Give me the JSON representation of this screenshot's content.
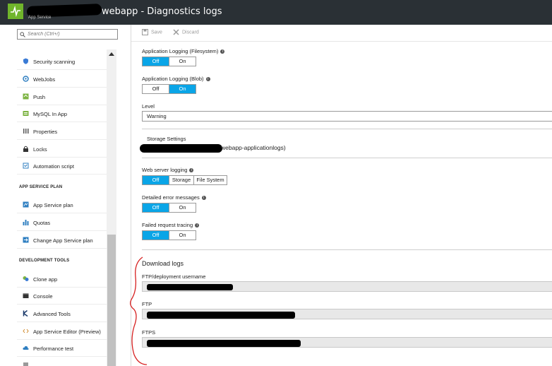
{
  "window": {
    "title": "webapp - Diagnostics logs",
    "subtitle": "App Service"
  },
  "sidebar": {
    "search_placeholder": "Search (Ctrl+/)",
    "items_top": [
      {
        "label": "Security scanning",
        "icon": "shield-icon"
      },
      {
        "label": "WebJobs",
        "icon": "webjobs-icon"
      },
      {
        "label": "Push",
        "icon": "push-icon"
      },
      {
        "label": "MySQL In App",
        "icon": "mysql-icon"
      },
      {
        "label": "Properties",
        "icon": "properties-icon"
      },
      {
        "label": "Locks",
        "icon": "lock-icon"
      },
      {
        "label": "Automation script",
        "icon": "script-icon"
      }
    ],
    "section_plan": "APP SERVICE PLAN",
    "items_plan": [
      {
        "label": "App Service plan",
        "icon": "app-service-plan-icon"
      },
      {
        "label": "Quotas",
        "icon": "quotas-icon"
      },
      {
        "label": "Change App Service plan",
        "icon": "change-plan-icon"
      }
    ],
    "section_dev": "DEVELOPMENT TOOLS",
    "items_dev": [
      {
        "label": "Clone app",
        "icon": "clone-icon"
      },
      {
        "label": "Console",
        "icon": "console-icon"
      },
      {
        "label": "Advanced Tools",
        "icon": "kudu-icon"
      },
      {
        "label": "App Service Editor (Preview)",
        "icon": "editor-icon"
      },
      {
        "label": "Performance test",
        "icon": "cloud-icon"
      }
    ]
  },
  "toolbar": {
    "save_label": "Save",
    "discard_label": "Discard"
  },
  "settings": {
    "app_logging_fs": {
      "label": "Application Logging (Filesystem)",
      "options": [
        "Off",
        "On"
      ],
      "selected": "Off"
    },
    "app_logging_blob": {
      "label": "Application Logging (Blob)",
      "options": [
        "Off",
        "On"
      ],
      "selected": "On"
    },
    "level": {
      "label": "Level",
      "value": "Warning"
    },
    "storage_settings": {
      "label": "Storage Settings",
      "value_suffix": "webapp-applicationlogs)"
    },
    "web_server_logging": {
      "label": "Web server logging",
      "options": [
        "Off",
        "Storage",
        "File System"
      ],
      "selected": "Off"
    },
    "detailed_errors": {
      "label": "Detailed error messages",
      "options": [
        "Off",
        "On"
      ],
      "selected": "Off"
    },
    "failed_request": {
      "label": "Failed request tracing",
      "options": [
        "Off",
        "On"
      ],
      "selected": "Off"
    }
  },
  "download": {
    "heading": "Download logs",
    "ftp_user_label": "FTP/deployment username",
    "ftp_label": "FTP",
    "ftps_label": "FTPS"
  },
  "colors": {
    "accent": "#0aa5e7",
    "titlebar": "#2a3035",
    "app_icon": "#70b52b",
    "annotation": "#d62020"
  }
}
